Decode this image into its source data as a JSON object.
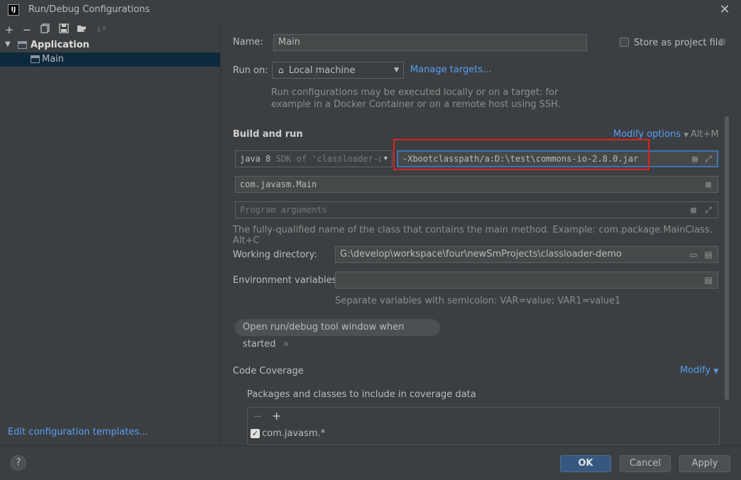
{
  "window": {
    "title": "Run/Debug Configurations",
    "logo": "IJ"
  },
  "toolbar": {
    "icons": [
      "add-icon",
      "remove-icon",
      "copy-icon",
      "save-icon",
      "folder-add-icon",
      "sort-icon"
    ]
  },
  "tree": {
    "group": "Application",
    "item": "Main"
  },
  "left_footer": {
    "edit_templates": "Edit configuration templates..."
  },
  "form": {
    "name_label": "Name:",
    "name_value": "Main",
    "store_as_project": "Store as project file",
    "run_on_label": "Run on:",
    "run_on_value": "Local machine",
    "manage_targets": "Manage targets...",
    "run_on_hint_1": "Run configurations may be executed locally or on a target: for",
    "run_on_hint_2": "example in a Docker Container or on a remote host using SSH.",
    "build_and_run": "Build and run",
    "modify_options": "Modify options",
    "modify_shortcut": "Alt+M",
    "sdk_value": "java 8",
    "sdk_suffix": "SDK of 'classloader-d",
    "vm_options": "-Xbootclasspath/a:D:\\test\\commons-io-2.8.0.jar",
    "main_class": "com.javasm.Main",
    "program_args_placeholder": "Program arguments",
    "main_class_hint": "The fully-qualified name of the class that contains the main method. Example: com.package.MainClass. Alt+C",
    "working_dir_label": "Working directory:",
    "working_dir_value": "G:\\develop\\workspace\\four\\newSmProjects\\classloader-demo",
    "env_label": "Environment variables:",
    "env_value": "",
    "env_hint": "Separate variables with semicolon: VAR=value; VAR1=value1",
    "tool_window_tag": "Open run/debug tool window when started",
    "code_coverage": "Code Coverage",
    "modify": "Modify",
    "coverage_packages": "Packages and classes to include in coverage data",
    "coverage_item": "com.javasm.*"
  },
  "buttons": {
    "ok": "OK",
    "cancel": "Cancel",
    "apply": "Apply",
    "help": "?"
  },
  "colors": {
    "accent": "#589df6",
    "highlight_box": "#e02020",
    "ok_button": "#365880"
  }
}
